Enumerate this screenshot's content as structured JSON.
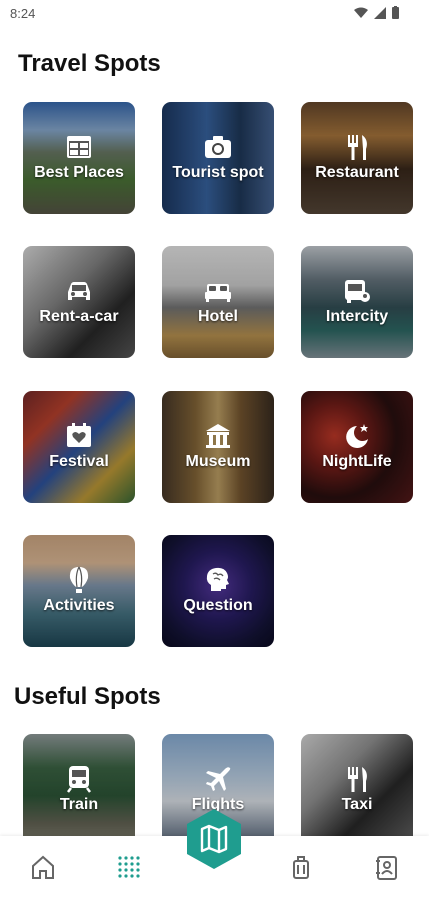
{
  "status": {
    "time": "8:24"
  },
  "sections": {
    "travel_title": "Travel Spots",
    "useful_title": "Useful Spots"
  },
  "travel_tiles": [
    {
      "label": "Best Places",
      "icon": "calendar-grid-icon"
    },
    {
      "label": "Tourist spot",
      "icon": "camera-icon"
    },
    {
      "label": "Restaurant",
      "icon": "fork-knife-icon"
    },
    {
      "label": "Rent-a-car",
      "icon": "car-icon"
    },
    {
      "label": "Hotel",
      "icon": "bed-icon"
    },
    {
      "label": "Intercity",
      "icon": "bus-icon"
    },
    {
      "label": "Festival",
      "icon": "heart-calendar-icon"
    },
    {
      "label": "Museum",
      "icon": "museum-icon"
    },
    {
      "label": "NightLife",
      "icon": "moon-star-icon"
    },
    {
      "label": "Activities",
      "icon": "hot-air-balloon-icon"
    },
    {
      "label": "Question",
      "icon": "brain-icon"
    }
  ],
  "useful_tiles": [
    {
      "label": "Train",
      "icon": "train-icon"
    },
    {
      "label": "Flights",
      "icon": "airplane-icon"
    },
    {
      "label": "Taxi",
      "icon": "fork-knife-icon"
    }
  ],
  "nav": {
    "items": [
      "home-icon",
      "grid-dots-icon",
      "map-icon",
      "luggage-icon",
      "contact-card-icon"
    ],
    "active_index": 2,
    "accent": "#1f9d8f"
  }
}
